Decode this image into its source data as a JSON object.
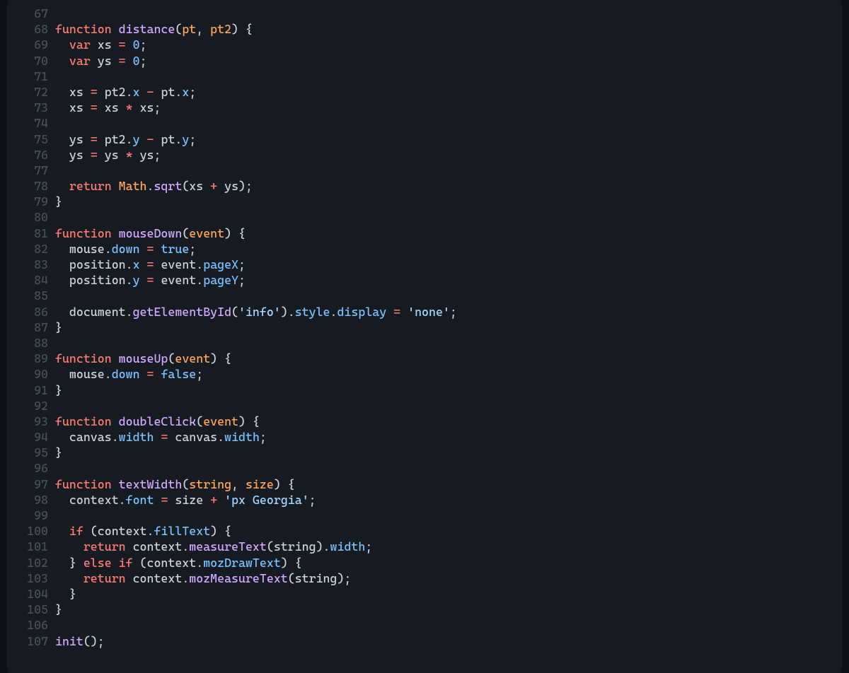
{
  "lines": [
    {
      "n": 67,
      "tokens": []
    },
    {
      "n": 68,
      "tokens": [
        {
          "c": "kw",
          "t": "function"
        },
        {
          "c": "punc",
          "t": " "
        },
        {
          "c": "fn",
          "t": "distance"
        },
        {
          "c": "punc",
          "t": "("
        },
        {
          "c": "param",
          "t": "pt"
        },
        {
          "c": "punc",
          "t": ", "
        },
        {
          "c": "param",
          "t": "pt2"
        },
        {
          "c": "punc",
          "t": ") {"
        }
      ]
    },
    {
      "n": 69,
      "tokens": [
        {
          "c": "punc",
          "t": "  "
        },
        {
          "c": "kw",
          "t": "var"
        },
        {
          "c": "punc",
          "t": " "
        },
        {
          "c": "ident",
          "t": "xs"
        },
        {
          "c": "punc",
          "t": " "
        },
        {
          "c": "kw",
          "t": "="
        },
        {
          "c": "punc",
          "t": " "
        },
        {
          "c": "num",
          "t": "0"
        },
        {
          "c": "punc",
          "t": ";"
        }
      ]
    },
    {
      "n": 70,
      "tokens": [
        {
          "c": "punc",
          "t": "  "
        },
        {
          "c": "kw",
          "t": "var"
        },
        {
          "c": "punc",
          "t": " "
        },
        {
          "c": "ident",
          "t": "ys"
        },
        {
          "c": "punc",
          "t": " "
        },
        {
          "c": "kw",
          "t": "="
        },
        {
          "c": "punc",
          "t": " "
        },
        {
          "c": "num",
          "t": "0"
        },
        {
          "c": "punc",
          "t": ";"
        }
      ]
    },
    {
      "n": 71,
      "tokens": []
    },
    {
      "n": 72,
      "tokens": [
        {
          "c": "punc",
          "t": "  "
        },
        {
          "c": "ident",
          "t": "xs"
        },
        {
          "c": "punc",
          "t": " "
        },
        {
          "c": "kw",
          "t": "="
        },
        {
          "c": "punc",
          "t": " "
        },
        {
          "c": "ident",
          "t": "pt2"
        },
        {
          "c": "punc",
          "t": "."
        },
        {
          "c": "prop",
          "t": "x"
        },
        {
          "c": "punc",
          "t": " "
        },
        {
          "c": "kw",
          "t": "-"
        },
        {
          "c": "punc",
          "t": " "
        },
        {
          "c": "ident",
          "t": "pt"
        },
        {
          "c": "punc",
          "t": "."
        },
        {
          "c": "prop",
          "t": "x"
        },
        {
          "c": "punc",
          "t": ";"
        }
      ]
    },
    {
      "n": 73,
      "tokens": [
        {
          "c": "punc",
          "t": "  "
        },
        {
          "c": "ident",
          "t": "xs"
        },
        {
          "c": "punc",
          "t": " "
        },
        {
          "c": "kw",
          "t": "="
        },
        {
          "c": "punc",
          "t": " "
        },
        {
          "c": "ident",
          "t": "xs"
        },
        {
          "c": "punc",
          "t": " "
        },
        {
          "c": "kw",
          "t": "*"
        },
        {
          "c": "punc",
          "t": " "
        },
        {
          "c": "ident",
          "t": "xs"
        },
        {
          "c": "punc",
          "t": ";"
        }
      ]
    },
    {
      "n": 74,
      "tokens": []
    },
    {
      "n": 75,
      "tokens": [
        {
          "c": "punc",
          "t": "  "
        },
        {
          "c": "ident",
          "t": "ys"
        },
        {
          "c": "punc",
          "t": " "
        },
        {
          "c": "kw",
          "t": "="
        },
        {
          "c": "punc",
          "t": " "
        },
        {
          "c": "ident",
          "t": "pt2"
        },
        {
          "c": "punc",
          "t": "."
        },
        {
          "c": "prop",
          "t": "y"
        },
        {
          "c": "punc",
          "t": " "
        },
        {
          "c": "kw",
          "t": "-"
        },
        {
          "c": "punc",
          "t": " "
        },
        {
          "c": "ident",
          "t": "pt"
        },
        {
          "c": "punc",
          "t": "."
        },
        {
          "c": "prop",
          "t": "y"
        },
        {
          "c": "punc",
          "t": ";"
        }
      ]
    },
    {
      "n": 76,
      "tokens": [
        {
          "c": "punc",
          "t": "  "
        },
        {
          "c": "ident",
          "t": "ys"
        },
        {
          "c": "punc",
          "t": " "
        },
        {
          "c": "kw",
          "t": "="
        },
        {
          "c": "punc",
          "t": " "
        },
        {
          "c": "ident",
          "t": "ys"
        },
        {
          "c": "punc",
          "t": " "
        },
        {
          "c": "kw",
          "t": "*"
        },
        {
          "c": "punc",
          "t": " "
        },
        {
          "c": "ident",
          "t": "ys"
        },
        {
          "c": "punc",
          "t": ";"
        }
      ]
    },
    {
      "n": 77,
      "tokens": []
    },
    {
      "n": 78,
      "tokens": [
        {
          "c": "punc",
          "t": "  "
        },
        {
          "c": "kw",
          "t": "return"
        },
        {
          "c": "punc",
          "t": " "
        },
        {
          "c": "obj",
          "t": "Math"
        },
        {
          "c": "punc",
          "t": "."
        },
        {
          "c": "call",
          "t": "sqrt"
        },
        {
          "c": "punc",
          "t": "("
        },
        {
          "c": "ident",
          "t": "xs"
        },
        {
          "c": "punc",
          "t": " "
        },
        {
          "c": "kw",
          "t": "+"
        },
        {
          "c": "punc",
          "t": " "
        },
        {
          "c": "ident",
          "t": "ys"
        },
        {
          "c": "punc",
          "t": ");"
        }
      ]
    },
    {
      "n": 79,
      "tokens": [
        {
          "c": "punc",
          "t": "}"
        }
      ]
    },
    {
      "n": 80,
      "tokens": []
    },
    {
      "n": 81,
      "tokens": [
        {
          "c": "kw",
          "t": "function"
        },
        {
          "c": "punc",
          "t": " "
        },
        {
          "c": "fn",
          "t": "mouseDown"
        },
        {
          "c": "punc",
          "t": "("
        },
        {
          "c": "param",
          "t": "event"
        },
        {
          "c": "punc",
          "t": ") {"
        }
      ]
    },
    {
      "n": 82,
      "tokens": [
        {
          "c": "punc",
          "t": "  "
        },
        {
          "c": "ident",
          "t": "mouse"
        },
        {
          "c": "punc",
          "t": "."
        },
        {
          "c": "prop",
          "t": "down"
        },
        {
          "c": "punc",
          "t": " "
        },
        {
          "c": "kw",
          "t": "="
        },
        {
          "c": "punc",
          "t": " "
        },
        {
          "c": "bool",
          "t": "true"
        },
        {
          "c": "punc",
          "t": ";"
        }
      ]
    },
    {
      "n": 83,
      "tokens": [
        {
          "c": "punc",
          "t": "  "
        },
        {
          "c": "ident",
          "t": "position"
        },
        {
          "c": "punc",
          "t": "."
        },
        {
          "c": "prop",
          "t": "x"
        },
        {
          "c": "punc",
          "t": " "
        },
        {
          "c": "kw",
          "t": "="
        },
        {
          "c": "punc",
          "t": " "
        },
        {
          "c": "ident",
          "t": "event"
        },
        {
          "c": "punc",
          "t": "."
        },
        {
          "c": "prop",
          "t": "pageX"
        },
        {
          "c": "punc",
          "t": ";"
        }
      ]
    },
    {
      "n": 84,
      "tokens": [
        {
          "c": "punc",
          "t": "  "
        },
        {
          "c": "ident",
          "t": "position"
        },
        {
          "c": "punc",
          "t": "."
        },
        {
          "c": "prop",
          "t": "y"
        },
        {
          "c": "punc",
          "t": " "
        },
        {
          "c": "kw",
          "t": "="
        },
        {
          "c": "punc",
          "t": " "
        },
        {
          "c": "ident",
          "t": "event"
        },
        {
          "c": "punc",
          "t": "."
        },
        {
          "c": "prop",
          "t": "pageY"
        },
        {
          "c": "punc",
          "t": ";"
        }
      ]
    },
    {
      "n": 85,
      "tokens": []
    },
    {
      "n": 86,
      "tokens": [
        {
          "c": "punc",
          "t": "  "
        },
        {
          "c": "ident",
          "t": "document"
        },
        {
          "c": "punc",
          "t": "."
        },
        {
          "c": "call",
          "t": "getElementById"
        },
        {
          "c": "punc",
          "t": "("
        },
        {
          "c": "str",
          "t": "'info'"
        },
        {
          "c": "punc",
          "t": ")."
        },
        {
          "c": "prop",
          "t": "style"
        },
        {
          "c": "punc",
          "t": "."
        },
        {
          "c": "prop",
          "t": "display"
        },
        {
          "c": "punc",
          "t": " "
        },
        {
          "c": "kw",
          "t": "="
        },
        {
          "c": "punc",
          "t": " "
        },
        {
          "c": "str",
          "t": "'none'"
        },
        {
          "c": "punc",
          "t": ";"
        }
      ]
    },
    {
      "n": 87,
      "tokens": [
        {
          "c": "punc",
          "t": "}"
        }
      ]
    },
    {
      "n": 88,
      "tokens": []
    },
    {
      "n": 89,
      "tokens": [
        {
          "c": "kw",
          "t": "function"
        },
        {
          "c": "punc",
          "t": " "
        },
        {
          "c": "fn",
          "t": "mouseUp"
        },
        {
          "c": "punc",
          "t": "("
        },
        {
          "c": "param",
          "t": "event"
        },
        {
          "c": "punc",
          "t": ") {"
        }
      ]
    },
    {
      "n": 90,
      "tokens": [
        {
          "c": "punc",
          "t": "  "
        },
        {
          "c": "ident",
          "t": "mouse"
        },
        {
          "c": "punc",
          "t": "."
        },
        {
          "c": "prop",
          "t": "down"
        },
        {
          "c": "punc",
          "t": " "
        },
        {
          "c": "kw",
          "t": "="
        },
        {
          "c": "punc",
          "t": " "
        },
        {
          "c": "bool",
          "t": "false"
        },
        {
          "c": "punc",
          "t": ";"
        }
      ]
    },
    {
      "n": 91,
      "tokens": [
        {
          "c": "punc",
          "t": "}"
        }
      ]
    },
    {
      "n": 92,
      "tokens": []
    },
    {
      "n": 93,
      "tokens": [
        {
          "c": "kw",
          "t": "function"
        },
        {
          "c": "punc",
          "t": " "
        },
        {
          "c": "fn",
          "t": "doubleClick"
        },
        {
          "c": "punc",
          "t": "("
        },
        {
          "c": "param",
          "t": "event"
        },
        {
          "c": "punc",
          "t": ") {"
        }
      ]
    },
    {
      "n": 94,
      "tokens": [
        {
          "c": "punc",
          "t": "  "
        },
        {
          "c": "ident",
          "t": "canvas"
        },
        {
          "c": "punc",
          "t": "."
        },
        {
          "c": "prop",
          "t": "width"
        },
        {
          "c": "punc",
          "t": " "
        },
        {
          "c": "kw",
          "t": "="
        },
        {
          "c": "punc",
          "t": " "
        },
        {
          "c": "ident",
          "t": "canvas"
        },
        {
          "c": "punc",
          "t": "."
        },
        {
          "c": "prop",
          "t": "width"
        },
        {
          "c": "punc",
          "t": ";"
        }
      ]
    },
    {
      "n": 95,
      "tokens": [
        {
          "c": "punc",
          "t": "}"
        }
      ]
    },
    {
      "n": 96,
      "tokens": []
    },
    {
      "n": 97,
      "tokens": [
        {
          "c": "kw",
          "t": "function"
        },
        {
          "c": "punc",
          "t": " "
        },
        {
          "c": "fn",
          "t": "textWidth"
        },
        {
          "c": "punc",
          "t": "("
        },
        {
          "c": "param",
          "t": "string"
        },
        {
          "c": "punc",
          "t": ", "
        },
        {
          "c": "param",
          "t": "size"
        },
        {
          "c": "punc",
          "t": ") {"
        }
      ]
    },
    {
      "n": 98,
      "tokens": [
        {
          "c": "punc",
          "t": "  "
        },
        {
          "c": "ident",
          "t": "context"
        },
        {
          "c": "punc",
          "t": "."
        },
        {
          "c": "prop",
          "t": "font"
        },
        {
          "c": "punc",
          "t": " "
        },
        {
          "c": "kw",
          "t": "="
        },
        {
          "c": "punc",
          "t": " "
        },
        {
          "c": "ident",
          "t": "size"
        },
        {
          "c": "punc",
          "t": " "
        },
        {
          "c": "kw",
          "t": "+"
        },
        {
          "c": "punc",
          "t": " "
        },
        {
          "c": "str",
          "t": "'px Georgia'"
        },
        {
          "c": "punc",
          "t": ";"
        }
      ]
    },
    {
      "n": 99,
      "tokens": []
    },
    {
      "n": 100,
      "tokens": [
        {
          "c": "punc",
          "t": "  "
        },
        {
          "c": "kw",
          "t": "if"
        },
        {
          "c": "punc",
          "t": " ("
        },
        {
          "c": "ident",
          "t": "context"
        },
        {
          "c": "punc",
          "t": "."
        },
        {
          "c": "prop",
          "t": "fillText"
        },
        {
          "c": "punc",
          "t": ") {"
        }
      ]
    },
    {
      "n": 101,
      "tokens": [
        {
          "c": "punc",
          "t": "    "
        },
        {
          "c": "kw",
          "t": "return"
        },
        {
          "c": "punc",
          "t": " "
        },
        {
          "c": "ident",
          "t": "context"
        },
        {
          "c": "punc",
          "t": "."
        },
        {
          "c": "call",
          "t": "measureText"
        },
        {
          "c": "punc",
          "t": "("
        },
        {
          "c": "ident",
          "t": "string"
        },
        {
          "c": "punc",
          "t": ")."
        },
        {
          "c": "prop",
          "t": "width"
        },
        {
          "c": "punc",
          "t": ";"
        }
      ]
    },
    {
      "n": 102,
      "tokens": [
        {
          "c": "punc",
          "t": "  } "
        },
        {
          "c": "kw",
          "t": "else"
        },
        {
          "c": "punc",
          "t": " "
        },
        {
          "c": "kw",
          "t": "if"
        },
        {
          "c": "punc",
          "t": " ("
        },
        {
          "c": "ident",
          "t": "context"
        },
        {
          "c": "punc",
          "t": "."
        },
        {
          "c": "prop",
          "t": "mozDrawText"
        },
        {
          "c": "punc",
          "t": ") {"
        }
      ]
    },
    {
      "n": 103,
      "tokens": [
        {
          "c": "punc",
          "t": "    "
        },
        {
          "c": "kw",
          "t": "return"
        },
        {
          "c": "punc",
          "t": " "
        },
        {
          "c": "ident",
          "t": "context"
        },
        {
          "c": "punc",
          "t": "."
        },
        {
          "c": "call",
          "t": "mozMeasureText"
        },
        {
          "c": "punc",
          "t": "("
        },
        {
          "c": "ident",
          "t": "string"
        },
        {
          "c": "punc",
          "t": ");"
        }
      ]
    },
    {
      "n": 104,
      "tokens": [
        {
          "c": "punc",
          "t": "  }"
        }
      ]
    },
    {
      "n": 105,
      "tokens": [
        {
          "c": "punc",
          "t": "}"
        }
      ]
    },
    {
      "n": 106,
      "tokens": []
    },
    {
      "n": 107,
      "tokens": [
        {
          "c": "call",
          "t": "init"
        },
        {
          "c": "punc",
          "t": "();"
        }
      ]
    }
  ]
}
